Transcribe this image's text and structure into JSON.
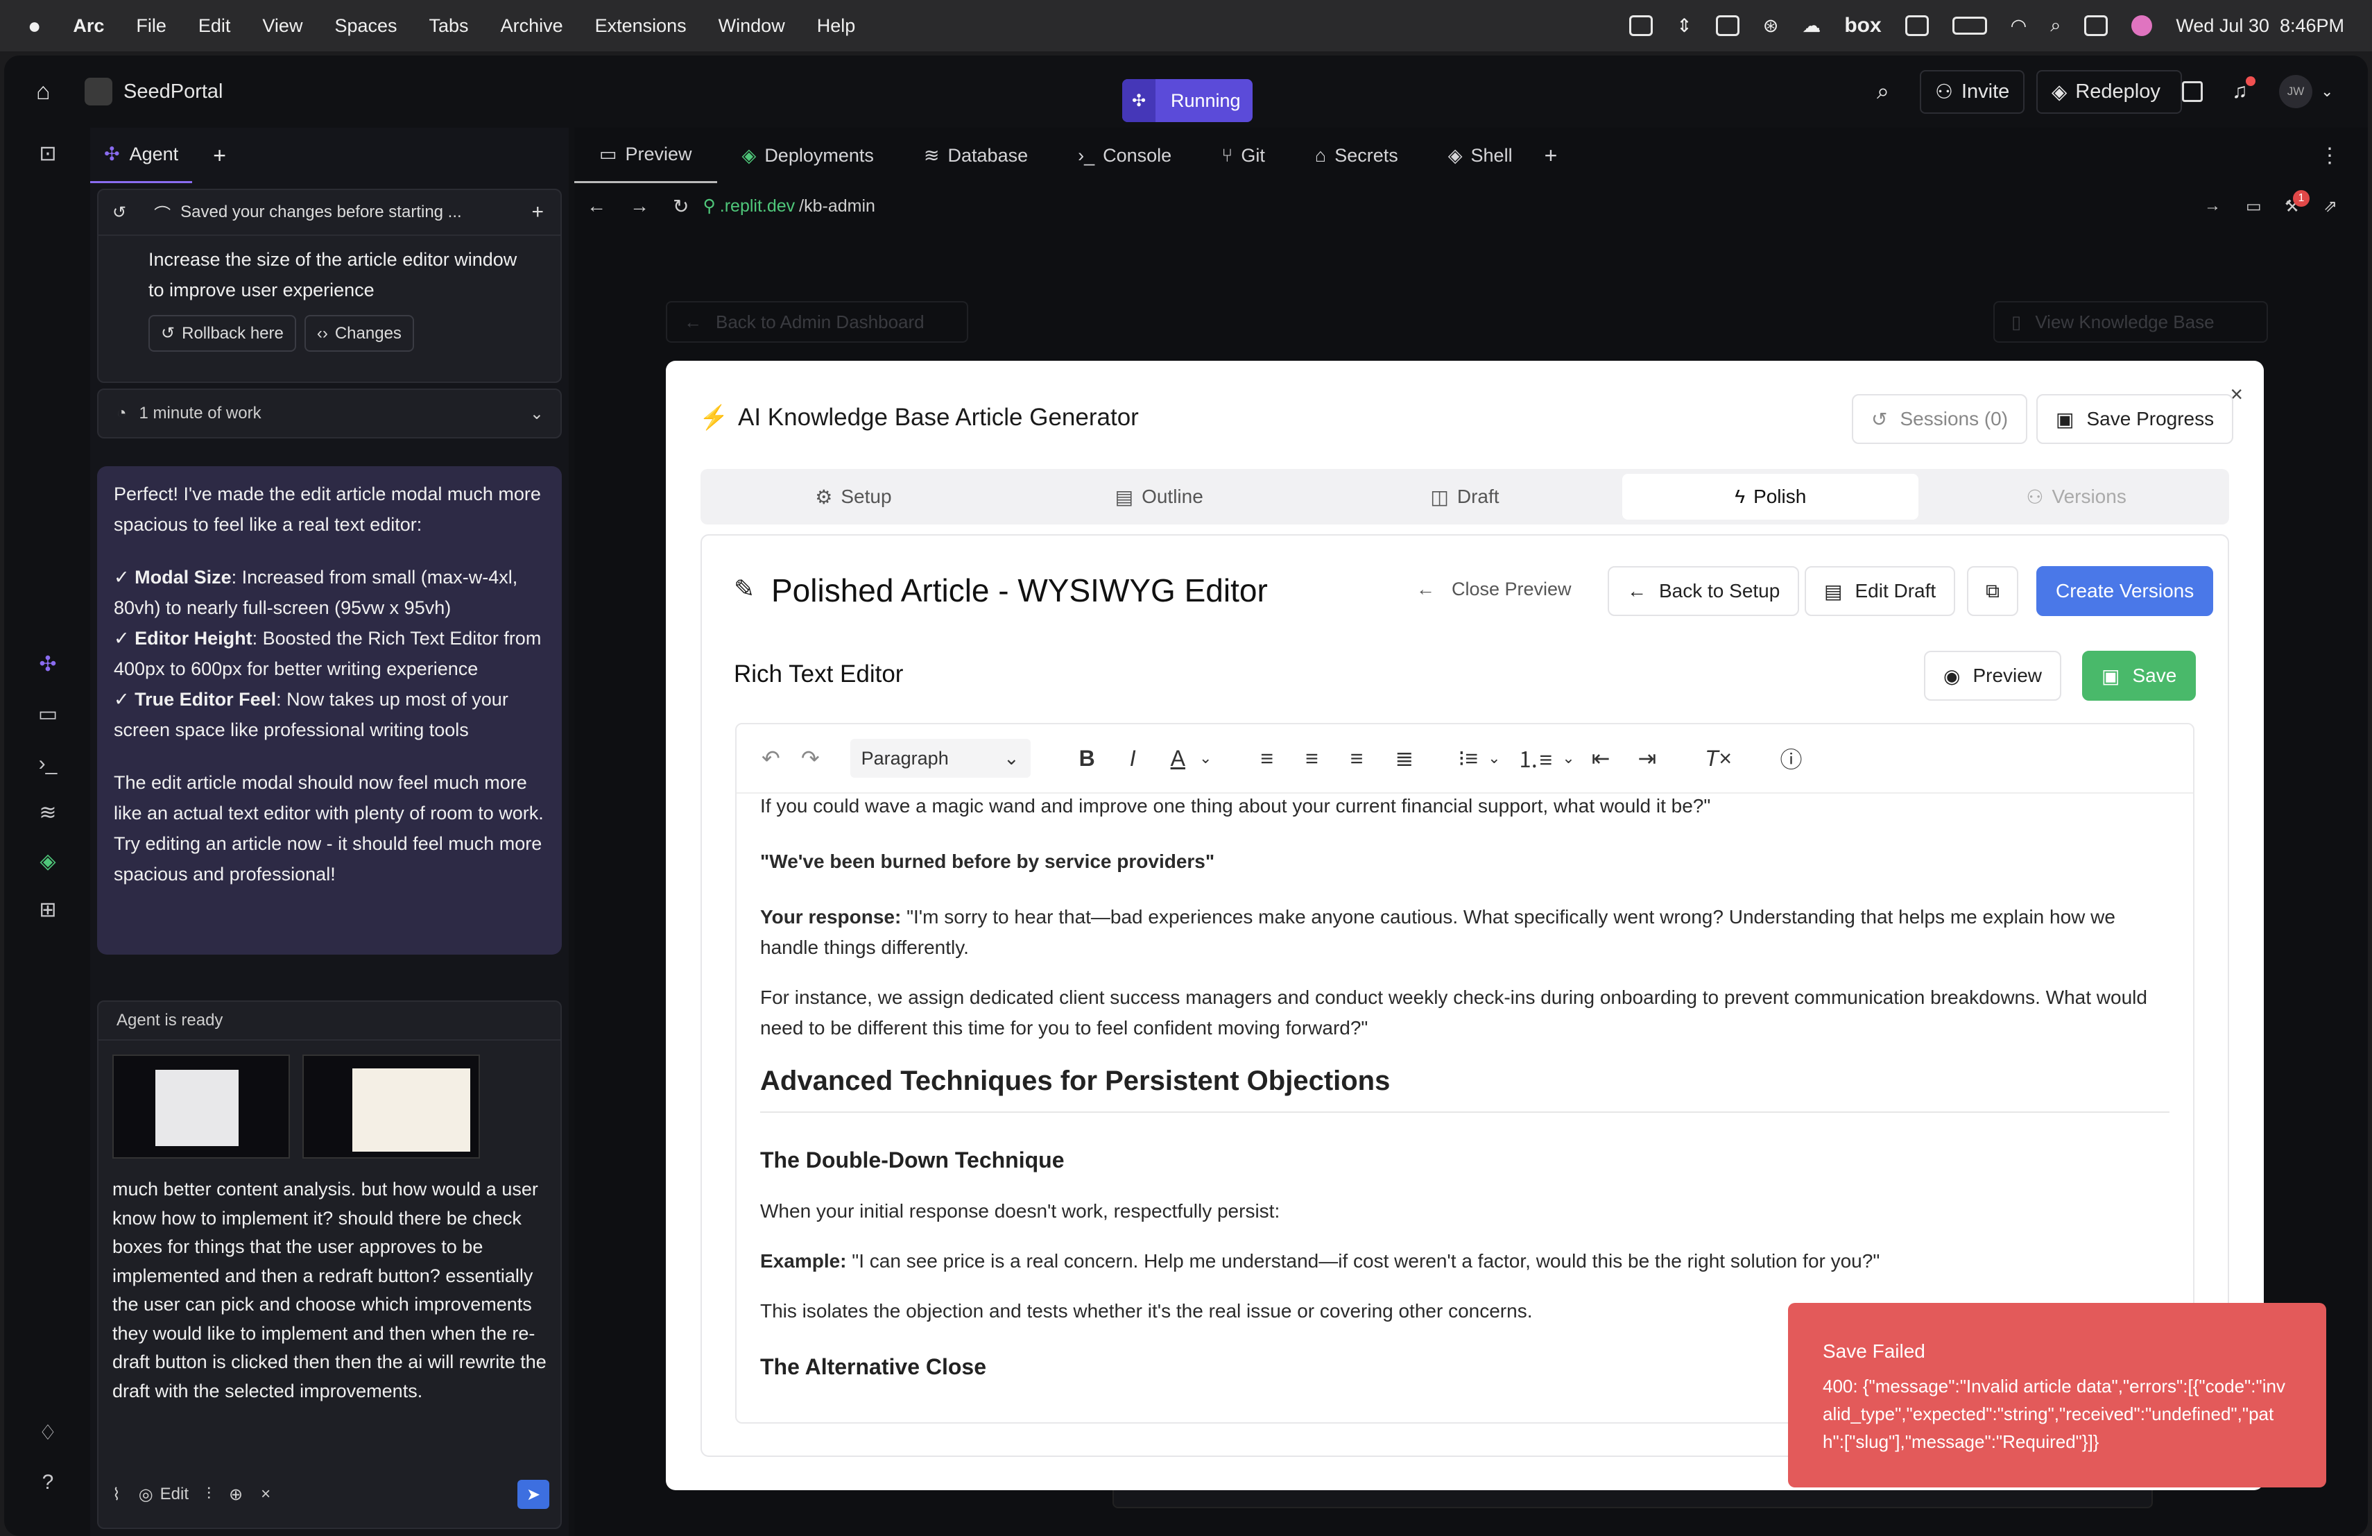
{
  "macos": {
    "menus": [
      "Arc",
      "File",
      "Edit",
      "View",
      "Spaces",
      "Tabs",
      "Archive",
      "Extensions",
      "Window",
      "Help"
    ],
    "box_label": "box",
    "datetime": "Wed Jul 30  8:46PM"
  },
  "topbar": {
    "project": "SeedPortal",
    "status": "Running",
    "invite": "Invite",
    "redeploy": "Redeploy",
    "avatar": "JW"
  },
  "agent": {
    "tab": "Agent",
    "saved_note": "Saved your changes before starting ...",
    "task": "Increase the size of the article editor window to improve user experience",
    "rollback": "Rollback here",
    "changes": "Changes",
    "work": "1 minute of work",
    "msg_intro": "Perfect! I've made the edit article modal much more spacious to feel like a real text editor:",
    "b1_head": "Modal Size",
    "b1_text": ": Increased from small (max-w-4xl, 80vh) to nearly full-screen (95vw x 95vh)",
    "b2_head": "Editor Height",
    "b2_text": ": Boosted the Rich Text Editor from 400px to 600px for better writing experience",
    "b3_head": "True Editor Feel",
    "b3_text": ": Now takes up most of your screen space like professional writing tools",
    "msg_outro": "The edit article modal should now feel much more like an actual text editor with plenty of room to work. Try editing an article now - it should feel much more spacious and professional!",
    "ready": "Agent is ready",
    "input_text": "much better content analysis. but how would a user know how to implement it? should there be check boxes for things that the user approves to be implemented and then a redraft button? essentially the user can pick and choose which improvements they would like to implement and then when the re-draft button is clicked then then the ai will rewrite the draft with the selected improvements.",
    "edit_label": "Edit"
  },
  "main": {
    "tabs": [
      "Preview",
      "Deployments",
      "Database",
      "Console",
      "Git",
      "Secrets",
      "Shell"
    ],
    "url_host": ".replit.dev",
    "url_path": "/kb-admin",
    "bg_back": "Back to Admin Dashboard",
    "bg_view": "View Knowledge Base"
  },
  "modal": {
    "title": "AI Knowledge Base Article Generator",
    "sessions": "Sessions (0)",
    "save_progress": "Save Progress",
    "tabs": [
      "Setup",
      "Outline",
      "Draft",
      "Polish",
      "Versions"
    ],
    "polished_title": "Polished Article - WYSIWYG Editor",
    "close_preview": "Close Preview",
    "back_setup": "Back to Setup",
    "edit_draft": "Edit Draft",
    "create_versions": "Create Versions",
    "rte_label": "Rich Text Editor",
    "preview": "Preview",
    "save": "Save",
    "paragraph": "Paragraph",
    "c1": "If you could wave a magic wand and improve one thing about your current financial support, what would it be?\"",
    "c2": "\"We've been burned before by service providers\"",
    "c3_b": "Your response:",
    "c3": " \"I'm sorry to hear that—bad experiences make anyone cautious. What specifically went wrong? Understanding that helps me explain how we handle things differently.",
    "c4": "For instance, we assign dedicated client success managers and conduct weekly check-ins during onboarding to prevent communication breakdowns. What would need to be different this time for you to feel confident moving forward?\"",
    "h2": "Advanced Techniques for Persistent Objections",
    "h3a": "The Double-Down Technique",
    "c5": "When your initial response doesn't work, respectfully persist:",
    "c6_b": "Example:",
    "c6": " \"I can see price is a real concern. Help me understand—if cost weren't a factor, would this be the right solution for you?\"",
    "c7": "This isolates the objection and tests whether it's the real issue or covering other concerns.",
    "h3b": "The Alternative Close"
  },
  "toast": {
    "title": "Save Failed",
    "body": "400: {\"message\":\"Invalid article data\",\"errors\":[{\"code\":\"invalid_type\",\"expected\":\"string\",\"received\":\"undefined\",\"path\":[\"slug\"],\"message\":\"Required\"}]}"
  },
  "colors": {
    "accent": "#4a78e8",
    "save_green": "#49b96a",
    "toast_red": "#e35a5a",
    "running": "#5b4bd9"
  }
}
